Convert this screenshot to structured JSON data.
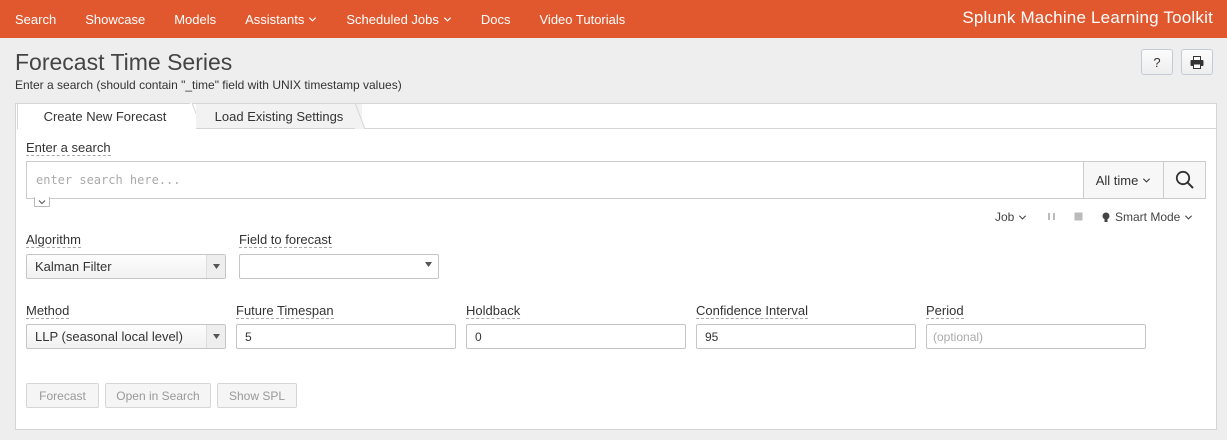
{
  "nav": {
    "items": [
      {
        "label": "Search"
      },
      {
        "label": "Showcase"
      },
      {
        "label": "Models"
      },
      {
        "label": "Assistants"
      },
      {
        "label": "Scheduled Jobs"
      },
      {
        "label": "Docs"
      },
      {
        "label": "Video Tutorials"
      }
    ],
    "brand": "Splunk Machine Learning Toolkit",
    "bar_color": "#e1582f"
  },
  "page": {
    "title": "Forecast Time Series",
    "subtitle": "Enter a search (should contain \"_time\" field with UNIX timestamp values)",
    "help_label": "?"
  },
  "tabs": [
    {
      "label": "Create New Forecast",
      "active": true
    },
    {
      "label": "Load Existing Settings",
      "active": false
    }
  ],
  "search": {
    "label": "Enter a search",
    "placeholder": "enter search here...",
    "time_range": "All time"
  },
  "job_bar": {
    "job_label": "Job",
    "mode_label": "Smart Mode"
  },
  "form": {
    "algorithm": {
      "label": "Algorithm",
      "value": "Kalman Filter"
    },
    "field_to_forecast": {
      "label": "Field to forecast",
      "value": ""
    },
    "method": {
      "label": "Method",
      "value": "LLP (seasonal local level)"
    },
    "future_timespan": {
      "label": "Future Timespan",
      "value": "5"
    },
    "holdback": {
      "label": "Holdback",
      "value": "0"
    },
    "confidence_interval": {
      "label": "Confidence Interval",
      "value": "95"
    },
    "period": {
      "label": "Period",
      "placeholder": "(optional)"
    }
  },
  "actions": {
    "forecast": "Forecast",
    "open_in_search": "Open in Search",
    "show_spl": "Show SPL"
  }
}
